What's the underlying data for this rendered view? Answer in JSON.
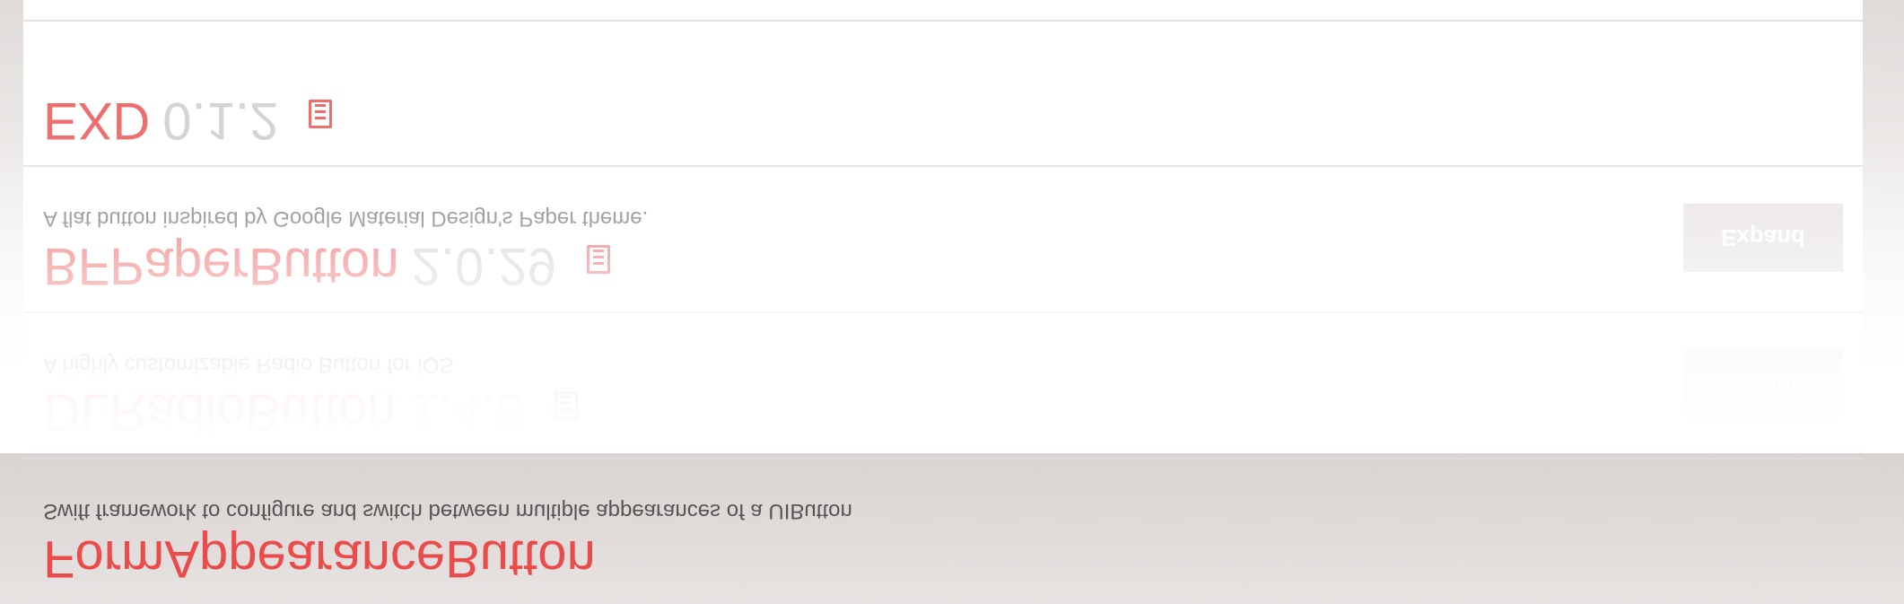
{
  "packages": [
    {
      "name": "EXD",
      "version": "0.1.2",
      "description": "",
      "expand_label": ""
    },
    {
      "name": "BFPaperButton",
      "version": "2.0.29",
      "description": "A flat button inspired by Google Material Design's Paper theme.",
      "expand_label": "Expand"
    },
    {
      "name": "DLRadioButton",
      "version": "1.4.8",
      "description": "A highly customizable Radio Button for iOS",
      "expand_label": "Expand"
    },
    {
      "name": "FormAppearanceButton",
      "version": "",
      "description": "Swift framework to configure and switch between multiple appearances of a UIButton",
      "expand_label": ""
    }
  ],
  "theme": {
    "name_color": "#ea4b4b",
    "version_color": "#c9c9c9",
    "button_bg": "#e1dcda",
    "icon": "document-icon"
  }
}
